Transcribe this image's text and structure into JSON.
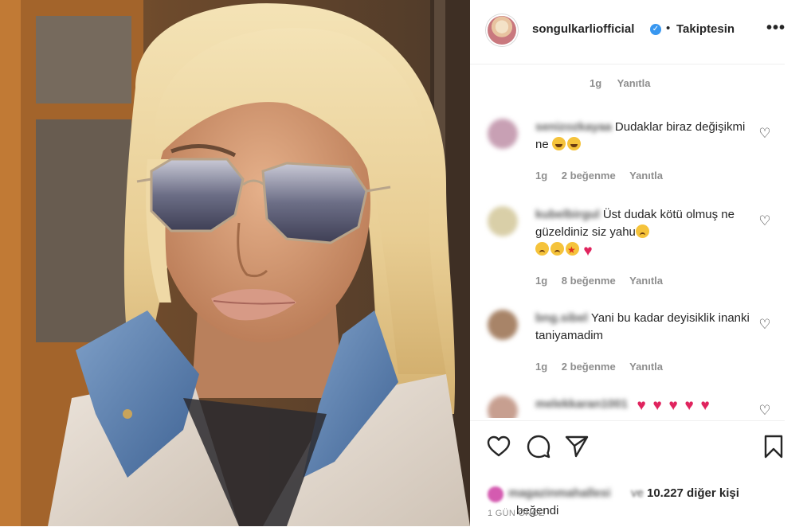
{
  "post": {
    "image_alt": "Selfie of a blonde woman with short bob haircut wearing tinted octagonal sunglasses and a denim jacket",
    "header": {
      "username": "songulkarliofficial",
      "verified": true,
      "separator": "•",
      "follow_status": "Takiptesin",
      "more_icon": "more-options-icon"
    },
    "top_meta": {
      "time": "1g",
      "reply": "Yanıtla"
    },
    "comments": [
      {
        "username": "senizozkayaa",
        "text": "Dudaklar biraz değişikmi ne",
        "emojis": [
          "laugh",
          "laugh"
        ],
        "time": "1g",
        "likes": "2 beğenme",
        "reply": "Yanıtla"
      },
      {
        "username": "kubelbirgul",
        "text": "Üst dudak kötü olmuş ne güzeldiniz siz yahu",
        "emojis_inline": [
          "sad"
        ],
        "emojis": [
          "sad",
          "sad",
          "star",
          "heart"
        ],
        "time": "1g",
        "likes": "8 beğenme",
        "reply": "Yanıtla"
      },
      {
        "username": "bng.sibel",
        "text": "Yani bu kadar deyisiklik inanki taniyamadim",
        "time": "1g",
        "likes": "2 beğenme",
        "reply": "Yanıtla"
      },
      {
        "username": "melekkaran1001",
        "emojis": [
          "heart",
          "heart",
          "heart",
          "heart",
          "heart"
        ]
      }
    ],
    "actions": {
      "like_icon": "heart-outline-icon",
      "comment_icon": "comment-icon",
      "share_icon": "send-icon",
      "save_icon": "bookmark-icon"
    },
    "likes": {
      "liked_by_user": "magazinmahallesi",
      "connector": "ve",
      "count_text": "10.227 diğer kişi",
      "suffix": "beğendi"
    },
    "time_ago": "1 GÜN ÖNCE"
  }
}
